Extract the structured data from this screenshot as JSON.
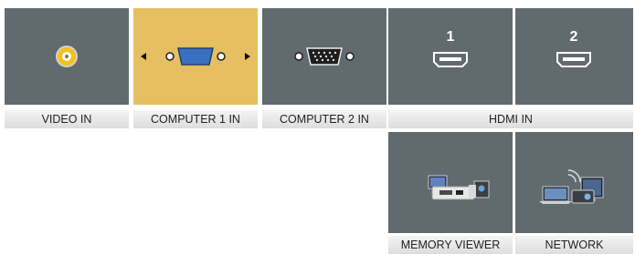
{
  "inputs": [
    {
      "label": "VIDEO IN",
      "icon": "rca-video-jack-icon"
    },
    {
      "label": "COMPUTER 1 IN",
      "icon": "vga-connector-icon",
      "selected": true
    },
    {
      "label": "COMPUTER 2 IN",
      "icon": "vga-connector-icon"
    },
    {
      "label": "HDMI IN",
      "icon": "hdmi-port-icon",
      "ports": [
        "1",
        "2"
      ]
    },
    {
      "label": "MEMORY VIEWER",
      "icon": "memory-viewer-icon"
    },
    {
      "label": "NETWORK",
      "icon": "network-devices-icon"
    }
  ],
  "colors": {
    "tile": "#616a6f",
    "selected_tile": "#e5bf61",
    "label_bg": "#e6e6e6",
    "vga_blue": "#3a70c0",
    "rca_yellow": "#f2c21a"
  }
}
